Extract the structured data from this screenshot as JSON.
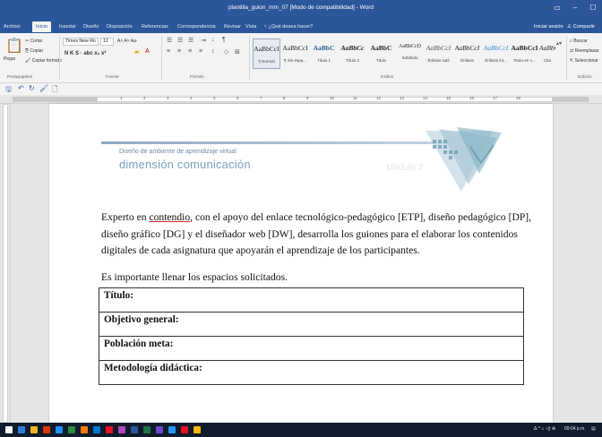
{
  "window": {
    "title": "plantilla_guion_mm_07 [Modo de compatibilidad] - Word",
    "controls": [
      "▭",
      "–",
      "☐"
    ]
  },
  "ribbon_tabs": [
    "Archivo",
    "Inicio",
    "Insertar",
    "Diseño",
    "Disposición",
    "Referencias",
    "Correspondencia",
    "Revisar",
    "Vista"
  ],
  "active_tab": "Inicio",
  "tell_me": "¿Qué desea hacer?",
  "account": {
    "signin": "Iniciar sesión",
    "share": "Compartir"
  },
  "clipboard": {
    "paste": "Pegar",
    "cut": "Cortar",
    "copy": "Copiar",
    "format_painter": "Copiar formato",
    "group": "Portapapeles"
  },
  "font": {
    "name": "Times New Ro",
    "size": "12",
    "group": "Fuente",
    "format_row": "N  K  S  ·  abc  x₂  x²"
  },
  "paragraph": {
    "group": "Párrafo"
  },
  "styles": {
    "group": "Estilos",
    "items": [
      {
        "sample": "AaBbCcI",
        "name": "¶ Normal"
      },
      {
        "sample": "AaBbCcI",
        "name": "¶ Sin espa..."
      },
      {
        "sample": "AaBbC",
        "name": "Título 1"
      },
      {
        "sample": "AaBbCc",
        "name": "Título 2"
      },
      {
        "sample": "AaBbC",
        "name": "Título"
      },
      {
        "sample": "AaBbCcD",
        "name": "Subtítulo"
      },
      {
        "sample": "AaBbCcI",
        "name": "Énfasis sutil"
      },
      {
        "sample": "AaBbCcI",
        "name": "Énfasis"
      },
      {
        "sample": "AaBbCcI",
        "name": "Énfasis int..."
      },
      {
        "sample": "AaBbCcI",
        "name": "Texto en n..."
      },
      {
        "sample": "AaBbCcI",
        "name": "Cita"
      }
    ]
  },
  "editing": {
    "find": "Buscar",
    "replace": "Reemplazar",
    "select": "Seleccionar",
    "group": "Edición"
  },
  "ruler": {
    "numbers": [
      "1",
      "2",
      "3",
      "4",
      "5",
      "6",
      "7",
      "8",
      "9",
      "10",
      "11",
      "12",
      "13",
      "14",
      "15",
      "16",
      "17",
      "18"
    ]
  },
  "document": {
    "header_subtitle": "Diseño de ambiente de aprendizaje virtual",
    "header_title": "dimensión comunicación",
    "header_module": "Módulo 2",
    "para1_pre": "Experto en ",
    "para1_link": "contendio",
    "para1_post": ", con el apoyo del enlace tecnológico-pedagógico [ETP], diseño pedagógico [DP], diseño gráfico [DG] y el diseñador web [DW], desarrolla los guiones para el elaborar los contenidos digitales de cada asignatura que apoyarán el aprendizaje de los participantes.",
    "para2": "Es importante llenar los espacios solicitados.",
    "table_rows": [
      "Título:",
      "Objetivo general:",
      "Población meta:",
      "Metodología didáctica:"
    ]
  },
  "taskbar": {
    "clock": "09:04 p.m.",
    "icon_colors": [
      "#ffffff",
      "#2c7fd8",
      "#f0b323",
      "#d83b01",
      "#1e90ff",
      "#2b8a3e",
      "#ff7a00",
      "#0078d7",
      "#e81123",
      "#b146c2",
      "#2b579a",
      "#217346",
      "#6d4ac9",
      "#2196f3",
      "#e81123",
      "#ffb900"
    ]
  }
}
